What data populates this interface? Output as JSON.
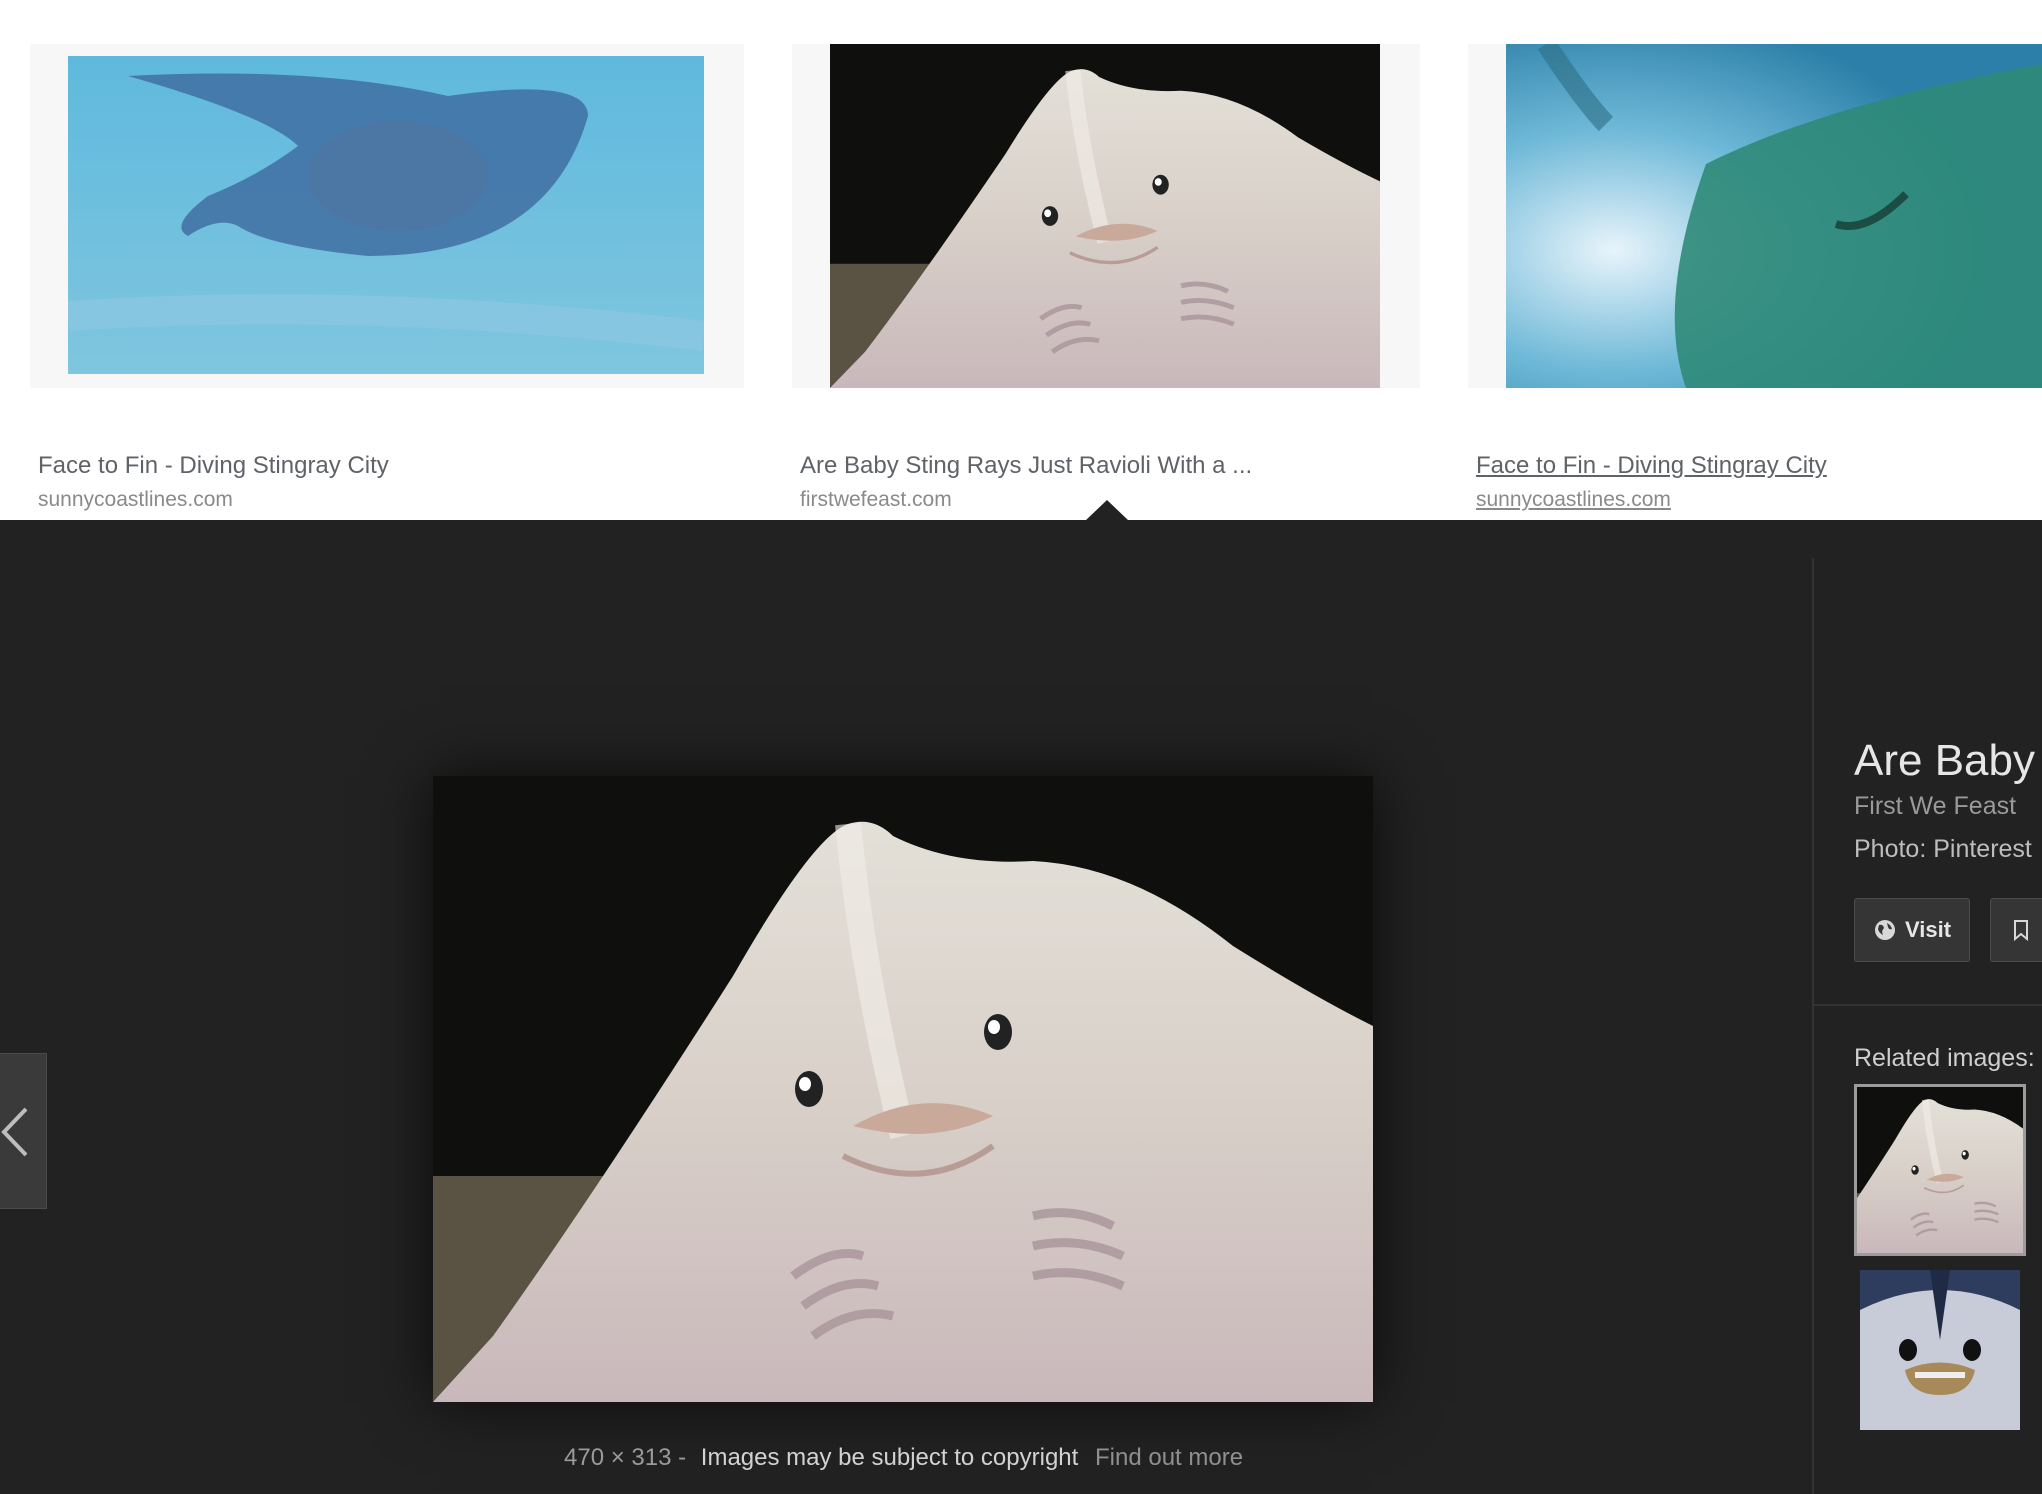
{
  "results": [
    {
      "title": "Face to Fin - Diving Stingray City",
      "source": "sunnycoastlines.com",
      "image": "stingray-on-sand"
    },
    {
      "title": "Are Baby Sting Rays Just Ravioli With a ...",
      "source": "firstwefeast.com",
      "image": "baby-stingray-underside"
    },
    {
      "title": "Face to Fin - Diving Stingray City",
      "source": "sunnycoastlines.com",
      "image": "stingray-from-below"
    }
  ],
  "preview": {
    "dimensions": "470 × 313",
    "separator": "-",
    "copyright": "Images may be subject to copyright",
    "find_out_more": "Find out more",
    "title": "Are Baby",
    "site": "First We Feast",
    "photo_credit": "Photo: Pinterest",
    "visit_label": "Visit",
    "related_label": "Related images:",
    "icons": {
      "visit": "globe-icon",
      "save": "bookmark-icon",
      "prev": "chevron-left-icon"
    }
  }
}
